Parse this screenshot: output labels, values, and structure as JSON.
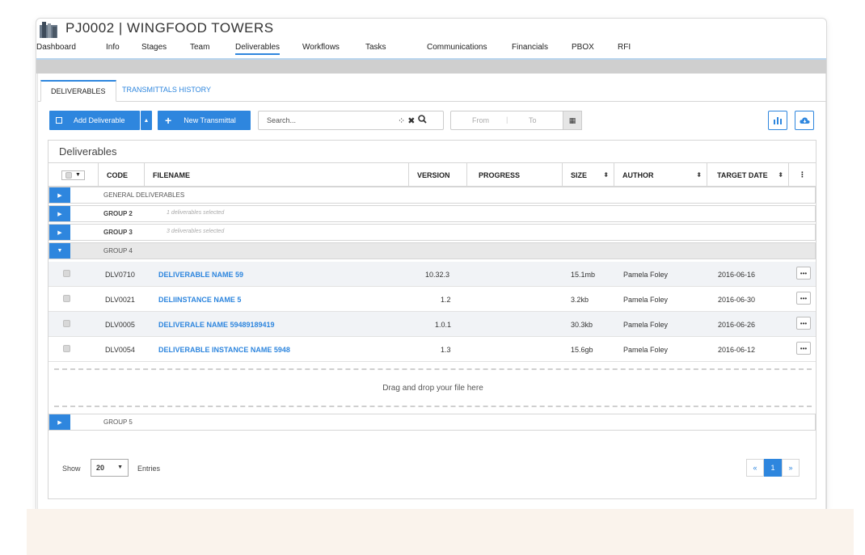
{
  "project": {
    "title": "PJ0002 | WINGFOOD TOWERS"
  },
  "nav": [
    "Dashboard",
    "Info",
    "Stages",
    "Team",
    "Deliverables",
    "Workflows",
    "Tasks",
    "Communications",
    "Financials",
    "PBOX",
    "RFI"
  ],
  "tabs": {
    "deliverables": "DELIVERABLES",
    "transmittals": "TRANSMITTALS HISTORY"
  },
  "toolbar": {
    "add_deliverable": "Add Deliverable",
    "new_transmittal": "New Transmittal",
    "search_placeholder": "Search...",
    "from": "From",
    "to": "To"
  },
  "table": {
    "title": "Deliverables",
    "headers": {
      "code": "CODE",
      "filename": "FILENAME",
      "version": "VERSION",
      "progress": "PROGRESS",
      "size": "SIZE",
      "author": "AUTHOR",
      "target_date": "TARGET DATE"
    },
    "groups": [
      {
        "name": "GENERAL DELIVERABLES",
        "selected": ""
      },
      {
        "name": "GROUP 2",
        "selected": "1 deliverables selected"
      },
      {
        "name": "GROUP 3",
        "selected": "3 deliverables selected"
      },
      {
        "name": "GROUP 4",
        "selected": ""
      },
      {
        "name": "GROUP 5",
        "selected": ""
      }
    ],
    "rows": [
      {
        "code": "DLV0710",
        "filename": "DELIVERABLE NAME 59",
        "version": "10.32.3",
        "size": "15.1mb",
        "author": "Pamela Foley",
        "date": "2016-06-16"
      },
      {
        "code": "DLV0021",
        "filename": "DELIINSTANCE NAME 5",
        "version": "1.2",
        "size": "3.2kb",
        "author": "Pamela Foley",
        "date": "2016-06-30"
      },
      {
        "code": "DLV0005",
        "filename": "DELIVERALE NAME 59489189419",
        "version": "1.0.1",
        "size": "30.3kb",
        "author": "Pamela Foley",
        "date": "2016-06-26"
      },
      {
        "code": "DLV0054",
        "filename": "DELIVERABLE INSTANCE NAME 5948",
        "version": "1.3",
        "size": "15.6gb",
        "author": "Pamela Foley",
        "date": "2016-06-12"
      }
    ],
    "dropzone": "Drag and drop your file here"
  },
  "footer": {
    "show": "Show",
    "entries_value": "20",
    "entries": "Entries",
    "prev": "«",
    "page": "1",
    "next": "»"
  },
  "colors": {
    "accent": "#2e86de"
  }
}
